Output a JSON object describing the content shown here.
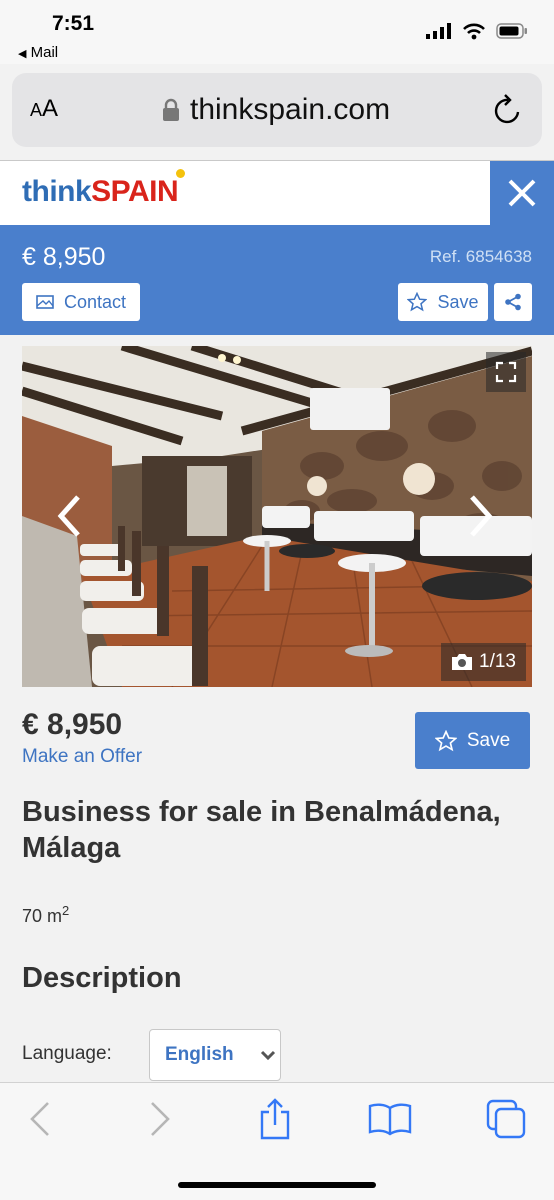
{
  "status_bar": {
    "time": "7:51",
    "back_label": "Mail"
  },
  "url_bar": {
    "text_size_label_small": "A",
    "text_size_label_large": "A",
    "domain": "thinkspain.com"
  },
  "site_header": {
    "logo_think": "think",
    "logo_spain": "SPAIN"
  },
  "listing_bar": {
    "price": "€ 8,950",
    "ref": "Ref. 6854638",
    "contact_label": "Contact",
    "save_label": "Save"
  },
  "photo": {
    "counter": "1/13"
  },
  "listing": {
    "price": "€ 8,950",
    "offer_link": "Make an Offer",
    "save_label": "Save",
    "title": "Business for sale in Benalmádena, Málaga",
    "area_value": "70 m",
    "area_unit_sup": "2",
    "description_heading": "Description",
    "language_label": "Language:",
    "language_selected": "English"
  },
  "colors": {
    "accent_blue": "#4a7fcc",
    "link_blue": "#3e74c2",
    "logo_red": "#d9241b"
  },
  "icons": [
    "back-chevron-icon",
    "signal-icon",
    "wifi-icon",
    "battery-icon",
    "lock-icon",
    "reload-icon",
    "close-icon",
    "envelope-icon",
    "star-icon",
    "share-icon",
    "expand-icon",
    "chevron-left-icon",
    "chevron-right-icon",
    "camera-icon",
    "chevron-down-icon",
    "browser-back-icon",
    "browser-forward-icon",
    "share-sheet-icon",
    "bookmarks-icon",
    "tabs-icon"
  ]
}
